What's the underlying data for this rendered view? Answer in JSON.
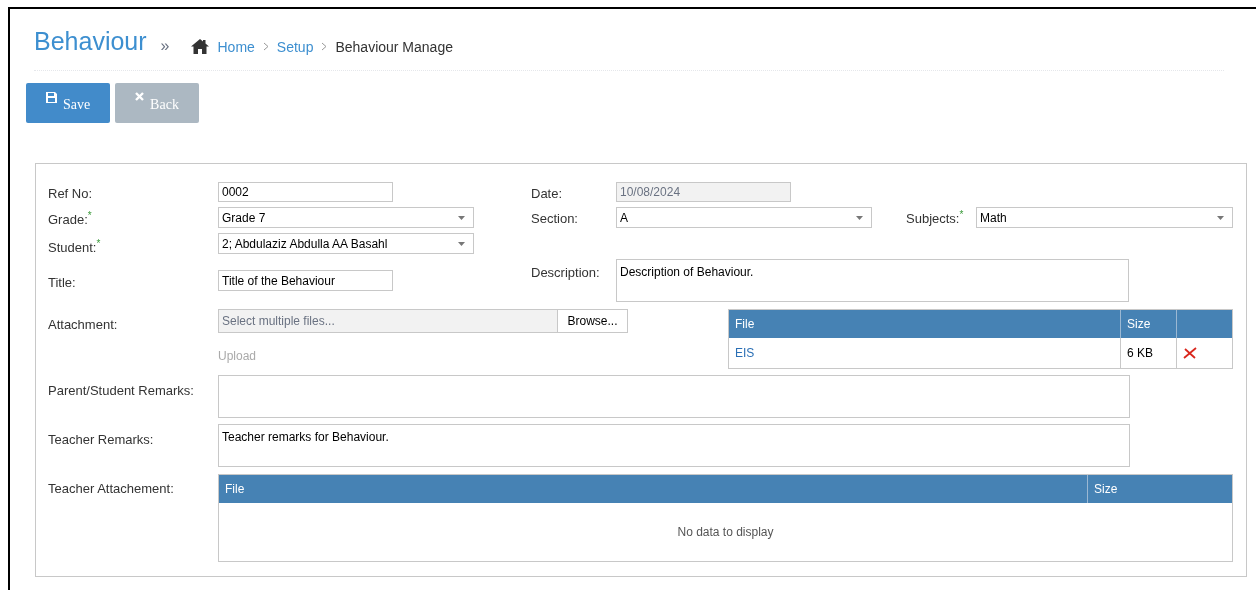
{
  "header": {
    "title": "Behaviour",
    "separator": "»",
    "breadcrumb": [
      {
        "label": "Home",
        "kind": "home",
        "current": false
      },
      {
        "label": "Setup",
        "kind": "link",
        "current": false
      },
      {
        "label": "Behaviour Manage",
        "kind": "link",
        "current": true
      }
    ]
  },
  "toolbar": [
    {
      "label": "Save",
      "kind": "save",
      "disabled": false
    },
    {
      "label": "Back",
      "kind": "back",
      "disabled": true
    }
  ],
  "form": {
    "ref_no": {
      "label": "Ref No:",
      "value": "0002"
    },
    "grade": {
      "label": "Grade:",
      "required_mark": "*",
      "value": "Grade 7"
    },
    "student": {
      "label": "Student:",
      "required_mark": "*",
      "value": "2; Abdulaziz Abdulla AA Basahl"
    },
    "title": {
      "label": "Title:",
      "value": "Title of the Behaviour"
    },
    "date": {
      "label": "Date:",
      "value": "10/08/2024",
      "disabled": true
    },
    "section": {
      "label": "Section:",
      "value": "A"
    },
    "subjects": {
      "label": "Subjects:",
      "required_mark": "*",
      "value": "Math"
    },
    "description": {
      "label": "Description:",
      "value": "Description of Behaviour."
    },
    "attachment": {
      "label": "Attachment:",
      "placeholder": "Select multiple files...",
      "browse": "Browse...",
      "upload": {
        "label": "Upload",
        "disabled": true
      },
      "table": {
        "columns": [
          "File",
          "Size"
        ],
        "rows": [
          {
            "file": "EIS",
            "size": "6 KB"
          }
        ]
      }
    },
    "parent_remarks": {
      "label": "Parent/Student Remarks:"
    },
    "teacher_remarks": {
      "label": "Teacher Remarks:",
      "value": "Teacher remarks for Behaviour."
    },
    "teacher_attachment": {
      "label": "Teacher Attachement:",
      "table": {
        "columns": [
          "File",
          "Size"
        ],
        "empty_text": "No data to display"
      }
    }
  }
}
